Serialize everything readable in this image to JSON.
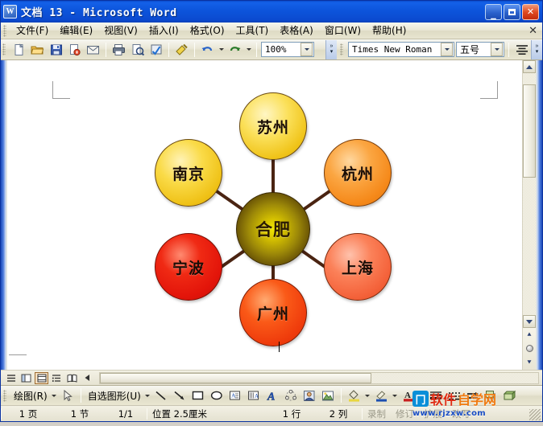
{
  "window": {
    "title": "文档 13 - Microsoft Word",
    "icon": "word-icon",
    "minimize_label": "_",
    "maximize_label": "□",
    "close_label": "✕"
  },
  "menubar": {
    "items": [
      {
        "label": "文件(F)"
      },
      {
        "label": "编辑(E)"
      },
      {
        "label": "视图(V)"
      },
      {
        "label": "插入(I)"
      },
      {
        "label": "格式(O)"
      },
      {
        "label": "工具(T)"
      },
      {
        "label": "表格(A)"
      },
      {
        "label": "窗口(W)"
      },
      {
        "label": "帮助(H)"
      }
    ],
    "close_doc_label": "✕"
  },
  "standard_toolbar": {
    "buttons": [
      {
        "name": "new-document-icon"
      },
      {
        "name": "open-folder-icon"
      },
      {
        "name": "save-icon"
      },
      {
        "name": "permission-icon"
      },
      {
        "name": "email-icon"
      },
      {
        "name": "print-icon"
      },
      {
        "name": "print-preview-icon"
      },
      {
        "name": "spelling-check-icon"
      },
      {
        "name": "format-painter-icon"
      },
      {
        "name": "undo-icon"
      },
      {
        "name": "redo-icon"
      }
    ],
    "zoom": {
      "value": "100%"
    },
    "overflow_label": "»"
  },
  "formatting_toolbar": {
    "font": {
      "value": "Times New Roman"
    },
    "size": {
      "value": "五号"
    },
    "align_icon": "align-center-icon",
    "overflow_label": "»"
  },
  "document": {
    "diagram": {
      "type": "radial",
      "center": {
        "label": "合肥",
        "color": "#8a7a0a",
        "edge": "#4a3a05"
      },
      "satellites": [
        {
          "label": "苏州",
          "color": "#f5cd2a",
          "edge": "#6a4a10",
          "angle": -90
        },
        {
          "label": "杭州",
          "color": "#f6921f",
          "edge": "#7a3c08",
          "angle": -35
        },
        {
          "label": "上海",
          "color": "#f4663a",
          "edge": "#7d2a0c",
          "angle": 35
        },
        {
          "label": "广州",
          "color": "#f03b10",
          "edge": "#7d1d05",
          "angle": 90
        },
        {
          "label": "宁波",
          "color": "#e8190b",
          "edge": "#7a1005",
          "angle": 145
        },
        {
          "label": "南京",
          "color": "#f2c823",
          "edge": "#6a4a10",
          "angle": -145
        }
      ],
      "spoke_color": "#4a2412"
    }
  },
  "view_bar": {
    "buttons": [
      {
        "name": "normal-view",
        "label": "≡"
      },
      {
        "name": "web-layout-view",
        "label": "▣"
      },
      {
        "name": "print-layout-view",
        "label": "▤",
        "selected": true
      },
      {
        "name": "outline-view",
        "label": "⋮≡"
      },
      {
        "name": "reading-layout-view",
        "label": "📖"
      },
      {
        "name": "scroll-left-arrow",
        "label": "◄"
      }
    ]
  },
  "drawing_toolbar": {
    "draw_menu_label": "绘图(R)",
    "autoshapes_label": "自选图形(U)",
    "buttons": [
      {
        "name": "select-objects-icon"
      },
      {
        "name": "line-icon"
      },
      {
        "name": "arrow-icon"
      },
      {
        "name": "rectangle-icon"
      },
      {
        "name": "oval-icon"
      },
      {
        "name": "text-box-icon"
      },
      {
        "name": "vertical-text-box-icon"
      },
      {
        "name": "wordart-icon"
      },
      {
        "name": "diagram-icon"
      },
      {
        "name": "clip-art-icon"
      },
      {
        "name": "insert-picture-icon"
      },
      {
        "name": "fill-color-icon"
      },
      {
        "name": "line-color-icon"
      },
      {
        "name": "font-color-icon"
      },
      {
        "name": "line-style-icon"
      },
      {
        "name": "dash-style-icon"
      },
      {
        "name": "arrow-style-icon"
      },
      {
        "name": "shadow-style-icon"
      },
      {
        "name": "3d-style-icon"
      }
    ]
  },
  "statusbar": {
    "page": "1 页",
    "section": "1 节",
    "page_of": "1/1",
    "position": "位置 2.5厘米",
    "line": "1 行",
    "column": "2 列",
    "rec": "录制",
    "trk": "修订",
    "ext": "扩展",
    "ovr": "改写"
  },
  "watermark": {
    "logo_char": "冂",
    "text_red": "软件",
    "text_orange": "自学网",
    "url": "www.rjzxw.com"
  }
}
